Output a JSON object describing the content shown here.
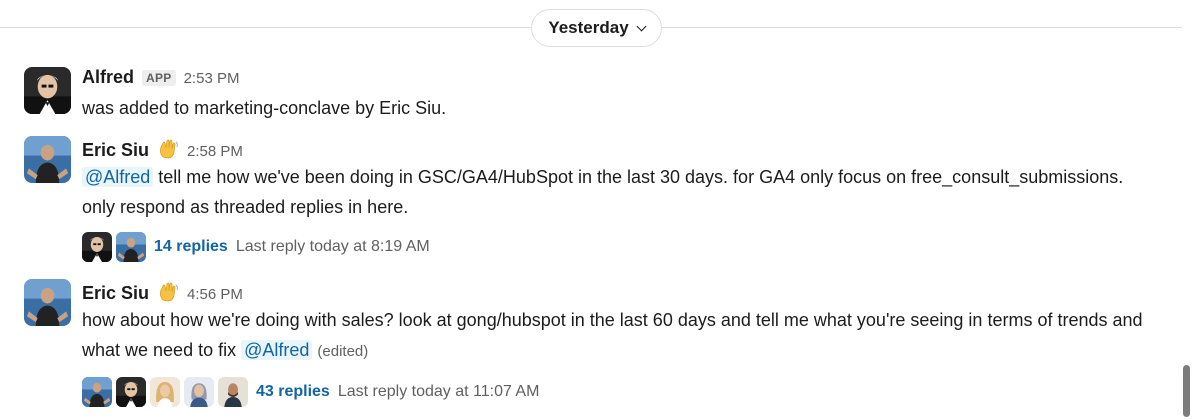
{
  "divider": {
    "label": "Yesterday",
    "icon": "chevron-down-icon"
  },
  "messages": [
    {
      "author": "Alfred",
      "badge": "APP",
      "time": "2:53 PM",
      "text": "was added to marketing-conclave by Eric Siu."
    },
    {
      "author": "Eric Siu",
      "status_emoji": "waving-hand-icon",
      "time": "2:58 PM",
      "mention": "@Alfred",
      "text": " tell me how we've been doing in GSC/GA4/HubSpot in the last 30 days. for GA4 only focus on free_consult_submissions. only respond as threaded replies in here.",
      "thread": {
        "replies": "14 replies",
        "last_reply": "Last reply today at 8:19 AM"
      }
    },
    {
      "author": "Eric Siu",
      "status_emoji": "waving-hand-icon",
      "time": "4:56 PM",
      "text": "how about how we're doing with sales? look at gong/hubspot in the last 60 days and tell me what you're seeing in terms of trends and what we need to fix ",
      "mention": "@Alfred",
      "edited": "(edited)",
      "thread": {
        "replies": "43 replies",
        "last_reply": "Last reply today at 11:07 AM"
      }
    }
  ],
  "colors": {
    "link": "#1264a3",
    "mention_bg": "#e8f5fa",
    "muted": "#616061",
    "text": "#1d1c1d"
  }
}
